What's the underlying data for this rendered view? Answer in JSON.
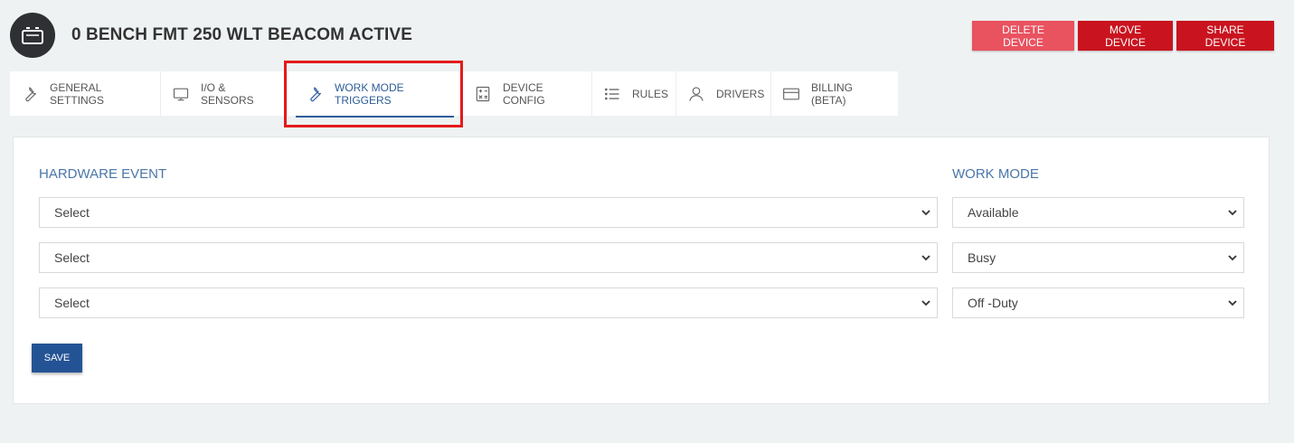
{
  "device": {
    "title": "0 BENCH FMT 250 WLT BEACOM ACTIVE"
  },
  "actions": {
    "delete_label": "DELETE DEVICE",
    "move_label": "MOVE DEVICE",
    "share_label": "SHARE DEVICE"
  },
  "tabs": [
    {
      "label": "GENERAL SETTINGS",
      "icon": "wrench-icon"
    },
    {
      "label": "I/O & SENSORS",
      "icon": "monitor-icon"
    },
    {
      "label": "WORK MODE TRIGGERS",
      "icon": "wrench-icon",
      "active": true
    },
    {
      "label": "DEVICE CONFIG",
      "icon": "calculator-icon"
    },
    {
      "label": "RULES",
      "icon": "list-icon"
    },
    {
      "label": "DRIVERS",
      "icon": "user-icon"
    },
    {
      "label": "BILLING (BETA)",
      "icon": "credit-card-icon"
    }
  ],
  "form": {
    "hardware_event_label": "HARDWARE EVENT",
    "work_mode_label": "WORK MODE",
    "rows": [
      {
        "hardware_event": "Select",
        "work_mode": "Available"
      },
      {
        "hardware_event": "Select",
        "work_mode": "Busy"
      },
      {
        "hardware_event": "Select",
        "work_mode": "Off -Duty"
      }
    ],
    "save_label": "SAVE"
  },
  "colors": {
    "accent": "#2d5c98",
    "danger": "#c9141f",
    "danger_light": "#e9525f",
    "annotation": "#e31b1b"
  }
}
